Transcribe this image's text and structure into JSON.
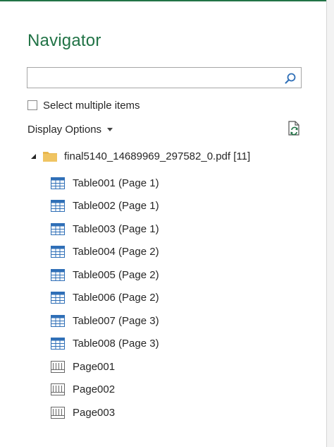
{
  "window": {
    "title": "Navigator"
  },
  "search": {
    "value": "",
    "placeholder": ""
  },
  "select_multiple": {
    "label": "Select multiple items",
    "checked": false
  },
  "display_options": {
    "label": "Display Options"
  },
  "tree": {
    "root": {
      "label": "final5140_14689969_297582_0.pdf [11]",
      "expanded": true,
      "icon": "folder-icon"
    },
    "items": [
      {
        "label": "Table001 (Page 1)",
        "icon": "table-icon"
      },
      {
        "label": "Table002 (Page 1)",
        "icon": "table-icon"
      },
      {
        "label": "Table003 (Page 1)",
        "icon": "table-icon"
      },
      {
        "label": "Table004 (Page 2)",
        "icon": "table-icon"
      },
      {
        "label": "Table005 (Page 2)",
        "icon": "table-icon"
      },
      {
        "label": "Table006 (Page 2)",
        "icon": "table-icon"
      },
      {
        "label": "Table007 (Page 3)",
        "icon": "table-icon"
      },
      {
        "label": "Table008 (Page 3)",
        "icon": "table-icon"
      },
      {
        "label": "Page001",
        "icon": "page-icon"
      },
      {
        "label": "Page002",
        "icon": "page-icon"
      },
      {
        "label": "Page003",
        "icon": "page-icon"
      }
    ]
  },
  "colors": {
    "accent": "#217346",
    "table_icon_header": "#2f6fb7",
    "folder": "#e8b64c"
  }
}
